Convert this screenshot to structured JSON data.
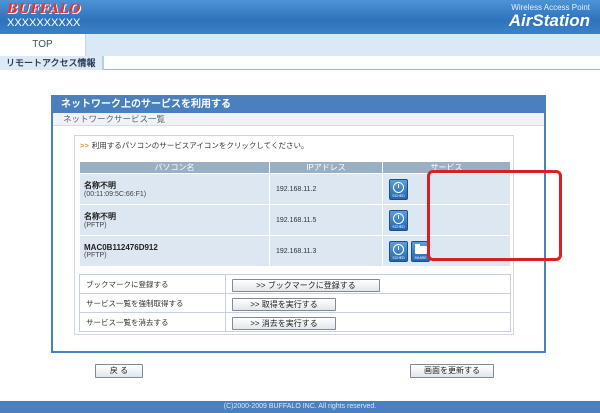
{
  "header": {
    "brand": "BUFFALO",
    "device_name": "XXXXXXXXXX",
    "subtitle": "Wireless Access Point",
    "product": "AirStation"
  },
  "nav": {
    "top_tab": "TOP"
  },
  "subnav": {
    "item": "リモートアクセス情報"
  },
  "panel": {
    "title": "ネットワーク上のサービスを利用する",
    "subtitle": "ネットワークサービス一覧",
    "hint": "利用するパソコンのサービスアイコンをクリックしてください。",
    "columns": [
      "パソコン名",
      "IPアドレス",
      "サービス"
    ],
    "rows": [
      {
        "name": "名称不明",
        "sub": "(00:11:09:5C:66:F1)",
        "ip": "192.168.11.2",
        "icons": [
          "clock-icon"
        ]
      },
      {
        "name": "名称不明",
        "sub": "(PFTP)",
        "ip": "192.168.11.5",
        "icons": [
          "clock-icon"
        ]
      },
      {
        "name": "MAC0B112476D912",
        "sub": "(PFTP)",
        "ip": "192.168.11.3",
        "icons": [
          "clock-icon",
          "folder-icon"
        ]
      }
    ],
    "actions": [
      {
        "label": "ブックマークに登録する",
        "button": ">> ブックマークに登録する"
      },
      {
        "label": "サービス一覧を強制取得する",
        "button": ">> 取得を実行する"
      },
      {
        "label": "サービス一覧を消去する",
        "button": ">> 消去を実行する"
      }
    ]
  },
  "buttons": {
    "back": "戻 る",
    "refresh": "画面を更新する"
  },
  "footer": "(C)2000-2009 BUFFALO INC. All rights reserved.",
  "colors": {
    "accent": "#4a80bd",
    "highlight": "#d81e29",
    "brand": "#e8352c"
  }
}
